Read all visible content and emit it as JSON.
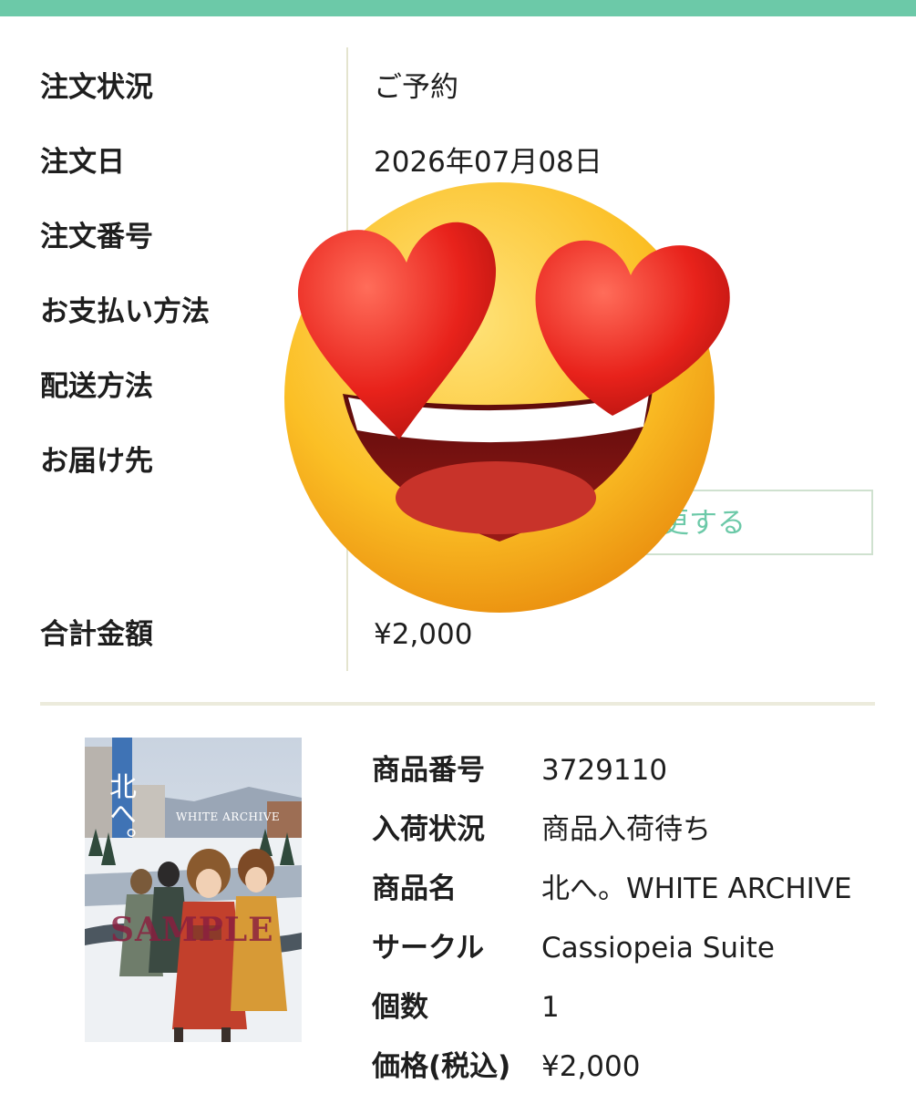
{
  "order": {
    "rows": [
      {
        "label": "注文状況",
        "value": "ご予約"
      },
      {
        "label": "注文日",
        "value": "2026年07月08日"
      },
      {
        "label": "注文番号",
        "value": ""
      },
      {
        "label": "お支払い方法",
        "value": ""
      },
      {
        "label": "配送方法",
        "value": ""
      },
      {
        "label": "お届け先",
        "value": ""
      }
    ],
    "change_button": "更する",
    "total_label": "合計金額",
    "total_value": "¥2,000"
  },
  "product": {
    "cover": {
      "title": "北へ。",
      "subtitle": "WHITE ARCHIVE",
      "watermark": "SAMPLE"
    },
    "details": [
      {
        "label": "商品番号",
        "value": "3729110"
      },
      {
        "label": "入荷状況",
        "value": "商品入荷待ち"
      },
      {
        "label": "商品名",
        "value": "北へ。WHITE ARCHIVE"
      },
      {
        "label": "サークル",
        "value": "Cassiopeia Suite"
      },
      {
        "label": "個数",
        "value": "1"
      },
      {
        "label": "価格(税込)",
        "value": "¥2,000"
      }
    ]
  },
  "overlay": {
    "icon": "heart-eyes-emoji-icon"
  },
  "colors": {
    "accent": "#6cc9a8",
    "divider": "#e4e4cf"
  }
}
